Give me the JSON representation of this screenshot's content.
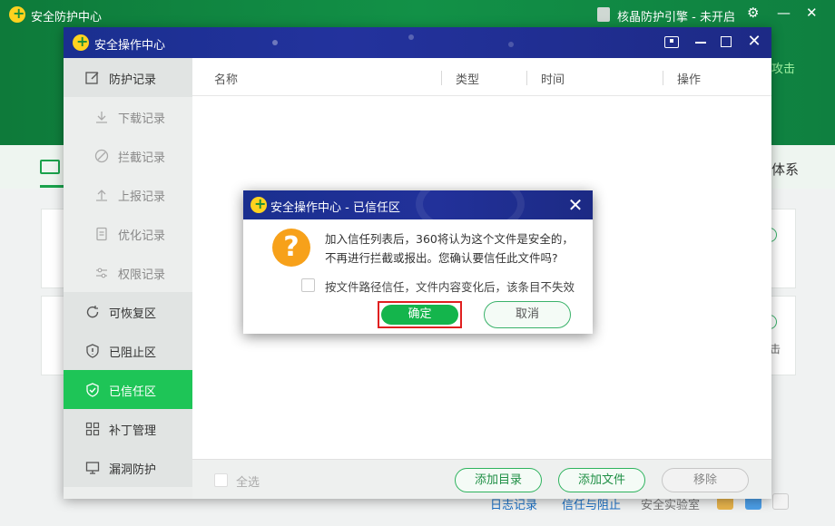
{
  "app": {
    "title": "安全防护中心",
    "engine_status": "核晶防护引擎 - 未开启",
    "attack_fragment": "攻击",
    "system_fragment": "体系",
    "card_fragment": "击"
  },
  "footer": {
    "links": [
      "日志记录",
      "信任与阻止",
      "安全实验室"
    ]
  },
  "window": {
    "title": "安全操作中心"
  },
  "sidebar": {
    "items": [
      {
        "label": "防护记录",
        "icon": "edit-icon"
      },
      {
        "label": "下载记录",
        "icon": "download-icon"
      },
      {
        "label": "拦截记录",
        "icon": "block-icon"
      },
      {
        "label": "上报记录",
        "icon": "upload-icon"
      },
      {
        "label": "优化记录",
        "icon": "doc-icon"
      },
      {
        "label": "权限记录",
        "icon": "permission-icon"
      },
      {
        "label": "可恢复区",
        "icon": "restore-icon"
      },
      {
        "label": "已阻止区",
        "icon": "blocked-shield-icon"
      },
      {
        "label": "已信任区",
        "icon": "trusted-shield-icon"
      },
      {
        "label": "补丁管理",
        "icon": "grid-icon"
      },
      {
        "label": "漏洞防护",
        "icon": "monitor-icon"
      }
    ],
    "active_index": 8
  },
  "table": {
    "columns": [
      "名称",
      "类型",
      "时间",
      "操作"
    ]
  },
  "bottom": {
    "select_all": "全选",
    "add_dir": "添加目录",
    "add_file": "添加文件",
    "remove": "移除"
  },
  "dialog": {
    "title": "安全操作中心 - 已信任区",
    "message": "加入信任列表后，360将认为这个文件是安全的，不再进行拦截或报出。您确认要信任此文件吗?",
    "checkbox_label": "按文件路径信任，文件内容变化后，该条目不失效",
    "ok": "确定",
    "cancel": "取消"
  },
  "colors": {
    "accent_green": "#1ec557",
    "title_blue": "#1a2f8f",
    "highlight_red": "#e02020",
    "warn_orange": "#f7a11a"
  }
}
